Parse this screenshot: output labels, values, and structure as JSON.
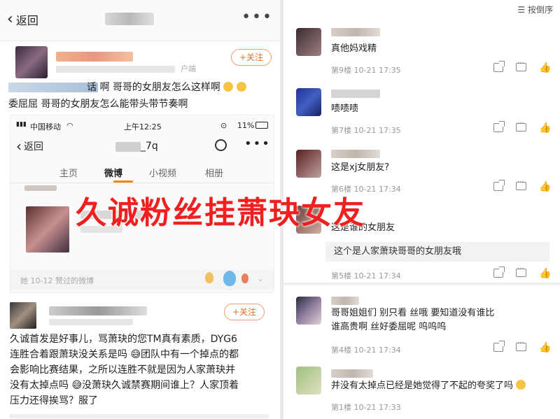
{
  "left": {
    "header": {
      "back_label": "返回",
      "more": "•••"
    },
    "post1": {
      "follow_label": "+关注",
      "source_suffix": "户端",
      "line1": "话  啊 哥哥的女朋友怎么这样啊",
      "line2": "委屈屈 哥哥的女朋友怎么能带头带节奏啊"
    },
    "phone": {
      "carrier": "中国移动",
      "time": "上午12:25",
      "battery": "11%",
      "back_label": "返回",
      "title_suffix": "_7q",
      "tabs": [
        "主页",
        "微博",
        "小视频",
        "相册"
      ],
      "active_tab": "微博",
      "liked_text": "她 10-12 赞过的微博"
    },
    "overlay_text": "久诚粉丝挂萧玦女友",
    "post2": {
      "follow_label": "+关注",
      "lines": [
        "久诚首发是好事儿，骂萧玦的您TM真有素质，DYG6",
        "连胜合着跟萧玦没关系是吗 😅团队中有一个掉点的都",
        "会影响比赛结果，之所以连胜不就是因为人家萧玦并",
        "没有太掉点吗 😅没萧玦久诚禁赛期间谁上？人家顶着",
        "压力还得挨骂？服了"
      ]
    }
  },
  "right": {
    "sort_label": "按倒序",
    "comments": [
      {
        "text": "真他妈戏精",
        "meta": "第9楼  10-21 17:35"
      },
      {
        "text": "啧啧啧",
        "meta": "第7楼  10-21 17:35"
      },
      {
        "text": "这是xj女朋友?",
        "meta": "第6楼  10-21 17:34"
      },
      {
        "text": "这是谁的女朋友",
        "reply": "这个是人家萧玦哥哥的女朋友哦",
        "meta": "第5楼  10-21 17:34"
      },
      {
        "text1": "哥哥姐姐们 别只看    丝哦  要知道没有谁比",
        "text2": "谁高贵啊             丝好委屈呢 呜呜呜",
        "meta": "第4楼  10-21 17:34"
      },
      {
        "text": "并没有太掉点已经是她觉得了不起的夸奖了吗",
        "meta": "第1楼  10-21 17:33"
      }
    ]
  },
  "colors": {
    "accent_orange": "#ff8200",
    "overlay_red": "#f02020"
  },
  "icons": [
    "back-chevron-icon",
    "more-dots-icon",
    "search-icon",
    "share-icon",
    "comment-icon",
    "like-icon",
    "sort-icon",
    "wifi-icon",
    "battery-icon"
  ]
}
